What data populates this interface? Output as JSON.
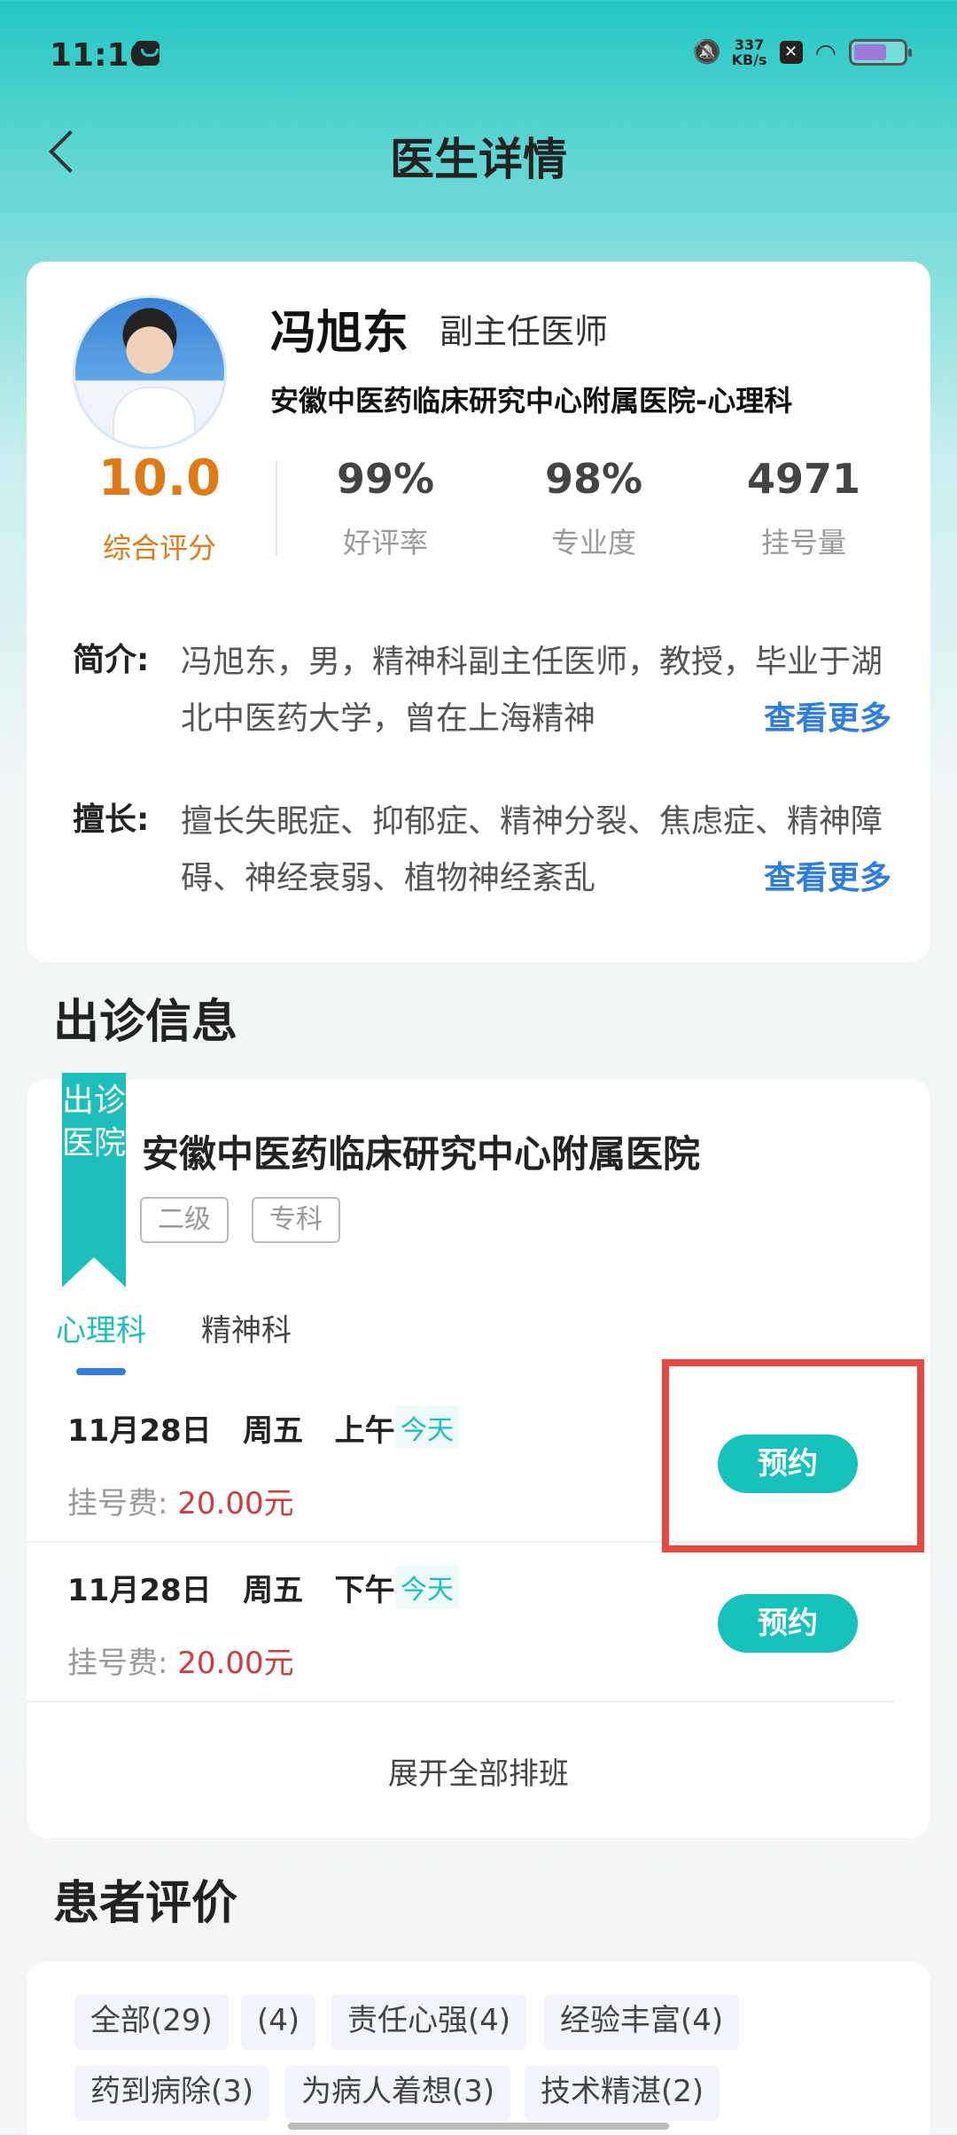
{
  "status_bar": {
    "time": "11:16",
    "speed_value": "337",
    "speed_unit": "KB/s"
  },
  "nav": {
    "title": "医生详情"
  },
  "doctor": {
    "name": "冯旭东",
    "title": "副主任医师",
    "department": "安徽中医药临床研究中心附属医院-心理科",
    "score": "10.0",
    "score_label": "综合评分",
    "stats": [
      {
        "value": "99%",
        "label": "好评率"
      },
      {
        "value": "98%",
        "label": "专业度"
      },
      {
        "value": "4971",
        "label": "挂号量"
      }
    ],
    "intro_label": "简介:",
    "intro_text": "冯旭东，男，精神科副主任医师，教授，毕业于湖北中医药大学，曾在上海精神",
    "specialty_label": "擅长:",
    "specialty_text": "擅长失眠症、抑郁症、精神分裂、焦虑症、精神障碍、神经衰弱、植物神经紊乱",
    "see_more": "查看更多"
  },
  "clinic_section": {
    "title": "出诊信息",
    "ribbon": "出诊医院",
    "hospital_name": "安徽中医药临床研究中心附属医院",
    "tags": [
      "二级",
      "专科"
    ],
    "tabs": [
      "心理科",
      "精神科"
    ],
    "slots": [
      {
        "date": "11月28日",
        "weekday": "周五",
        "period": "上午",
        "badge": "今天",
        "fee_label": "挂号费:",
        "fee": "20.00元",
        "button": "预约"
      },
      {
        "date": "11月28日",
        "weekday": "周五",
        "period": "下午",
        "badge": "今天",
        "fee_label": "挂号费:",
        "fee": "20.00元",
        "button": "预约"
      }
    ],
    "expand_all": "展开全部排班"
  },
  "review_section": {
    "title": "患者评价",
    "tags": [
      "全部(29)",
      "(4)",
      "责任心强(4)",
      "经验丰富(4)",
      "药到病除(3)",
      "为病人着想(3)",
      "技术精湛(2)"
    ]
  },
  "colors": {
    "accent": "#1ebfba",
    "link": "#2f7de1",
    "score": "#e07a17",
    "fee": "#d23b3b",
    "highlight": "#e8483f"
  }
}
